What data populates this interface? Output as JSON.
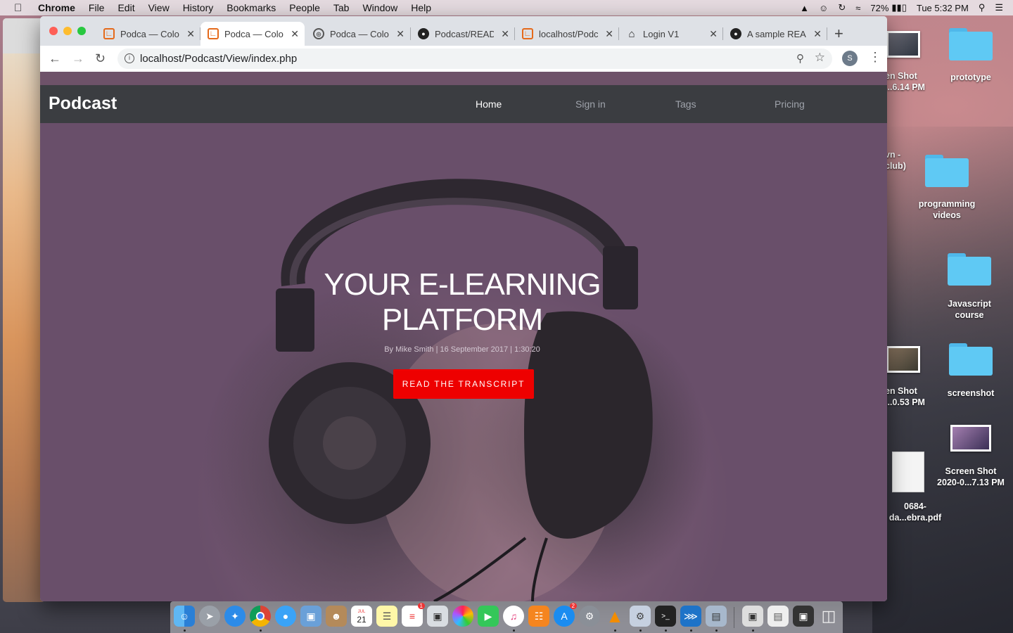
{
  "menubar": {
    "app": "Chrome",
    "items": [
      "File",
      "Edit",
      "View",
      "History",
      "Bookmarks",
      "People",
      "Tab",
      "Window",
      "Help"
    ],
    "battery": "72%",
    "clock": "Tue 5:32 PM"
  },
  "browser": {
    "tabs": [
      {
        "title": "Podca — Colo",
        "favicon": "xampp-icon"
      },
      {
        "title": "Podca — Colo",
        "favicon": "xampp-icon"
      },
      {
        "title": "Podca — Colo",
        "favicon": "globe-icon"
      },
      {
        "title": "Podcast/READ",
        "favicon": "github-icon"
      },
      {
        "title": "localhost/Podc",
        "favicon": "xampp-icon"
      },
      {
        "title": "Login V1",
        "favicon": "home-icon"
      },
      {
        "title": "A sample REA",
        "favicon": "github-icon"
      }
    ],
    "url": "localhost/Podcast/View/index.php",
    "profile_initial": "S"
  },
  "site": {
    "brand": "Podcast",
    "nav": [
      "Home",
      "Sign in",
      "Tags",
      "Pricing"
    ],
    "headline_line1": "YOUR E-LEARNING",
    "headline_line2": "PLATFORM",
    "byline": "By Mike Smith | 16 September 2017 | 1:30:20",
    "cta": "READ THE TRANSCRIPT",
    "accent": "#ee0000"
  },
  "desktop": {
    "icons": [
      {
        "label1": "en Shot",
        "label2": "...6.14 PM"
      },
      {
        "label1": "prototype",
        "label2": ""
      },
      {
        "label1": "vn -",
        "label2": "club)"
      },
      {
        "label1": "programming",
        "label2": "videos"
      },
      {
        "label1": "Javascript",
        "label2": "course"
      },
      {
        "label1": "en Shot",
        "label2": "...0.53 PM"
      },
      {
        "label1": "screenshot",
        "label2": ""
      },
      {
        "label1": "Screen Shot",
        "label2": "2020-0...7.13 PM"
      },
      {
        "label1": "0684-",
        "label2": "da...ebra.pdf"
      }
    ]
  },
  "dock": {
    "calendar_day": "21",
    "calendar_month": "JUL",
    "badge_reminders": "1",
    "badge_appstore": "2"
  }
}
